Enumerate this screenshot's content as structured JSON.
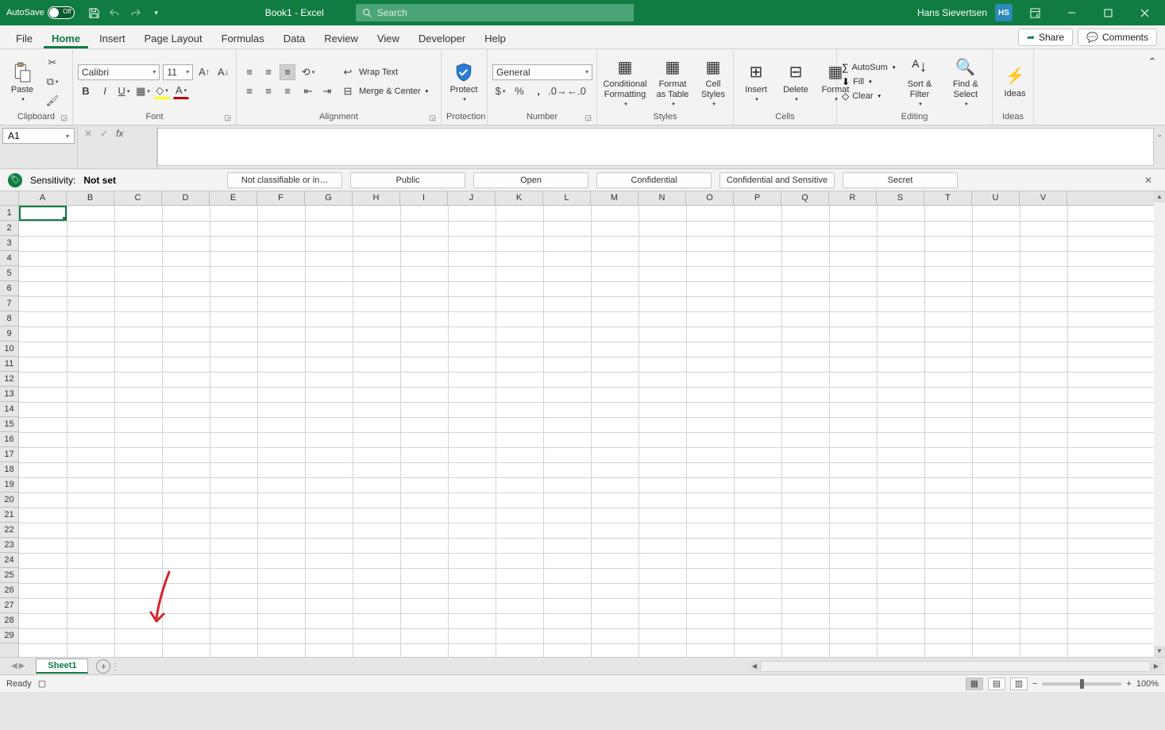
{
  "titlebar": {
    "autosave_label": "AutoSave",
    "autosave_state": "Off",
    "doc_title": "Book1  -  Excel",
    "search_placeholder": "Search",
    "user_name": "Hans Sievertsen",
    "user_initials": "HS"
  },
  "menubar": {
    "items": [
      "File",
      "Home",
      "Insert",
      "Page Layout",
      "Formulas",
      "Data",
      "Review",
      "View",
      "Developer",
      "Help"
    ],
    "active_index": 1,
    "share_label": "Share",
    "comments_label": "Comments"
  },
  "ribbon": {
    "clipboard": {
      "paste": "Paste",
      "label": "Clipboard"
    },
    "font": {
      "name": "Calibri",
      "size": "11",
      "label": "Font"
    },
    "alignment": {
      "wrap": "Wrap Text",
      "merge": "Merge & Center",
      "label": "Alignment"
    },
    "protection": {
      "protect": "Protect",
      "label": "Protection"
    },
    "number": {
      "format": "General",
      "label": "Number"
    },
    "styles": {
      "cond": "Conditional Formatting",
      "table": "Format as Table",
      "cell": "Cell Styles",
      "label": "Styles"
    },
    "cells": {
      "insert": "Insert",
      "delete": "Delete",
      "format": "Format",
      "label": "Cells"
    },
    "editing": {
      "sum": "AutoSum",
      "fill": "Fill",
      "clear": "Clear",
      "sort": "Sort & Filter",
      "find": "Find & Select",
      "label": "Editing"
    },
    "ideas": {
      "ideas": "Ideas",
      "label": "Ideas"
    }
  },
  "formula_bar": {
    "cell_ref": "A1",
    "formula": ""
  },
  "sensitivity": {
    "label": "Sensitivity:",
    "value": "Not set",
    "chips": [
      "Not classifiable or in…",
      "Public",
      "Open",
      "Confidential",
      "Confidential and Sensitive",
      "Secret"
    ]
  },
  "grid": {
    "columns": [
      "A",
      "B",
      "C",
      "D",
      "E",
      "F",
      "G",
      "H",
      "I",
      "J",
      "K",
      "L",
      "M",
      "N",
      "O",
      "P",
      "Q",
      "R",
      "S",
      "T",
      "U",
      "V"
    ],
    "rows": 29,
    "selected_cell": "A1"
  },
  "sheets": {
    "active": "Sheet1"
  },
  "statusbar": {
    "state": "Ready",
    "zoom": "100%"
  }
}
